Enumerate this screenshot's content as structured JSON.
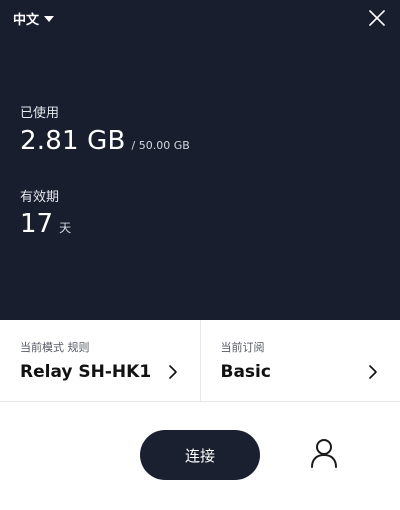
{
  "header": {
    "language_label": "中文"
  },
  "usage": {
    "label": "已使用",
    "used": "2.81 GB",
    "total": "/ 50.00 GB"
  },
  "validity": {
    "label": "有效期",
    "days": "17",
    "unit": "天"
  },
  "mode_card": {
    "label": "当前模式 规则",
    "value": "Relay SH-HK1"
  },
  "subscription_card": {
    "label": "当前订阅",
    "value": "Basic"
  },
  "actions": {
    "connect_label": "连接"
  },
  "colors": {
    "panel_background": "#181e2e",
    "button_background": "#1a2030"
  },
  "icons": [
    "caret-down-icon",
    "close-icon",
    "chevron-right-icon",
    "user-icon"
  ]
}
